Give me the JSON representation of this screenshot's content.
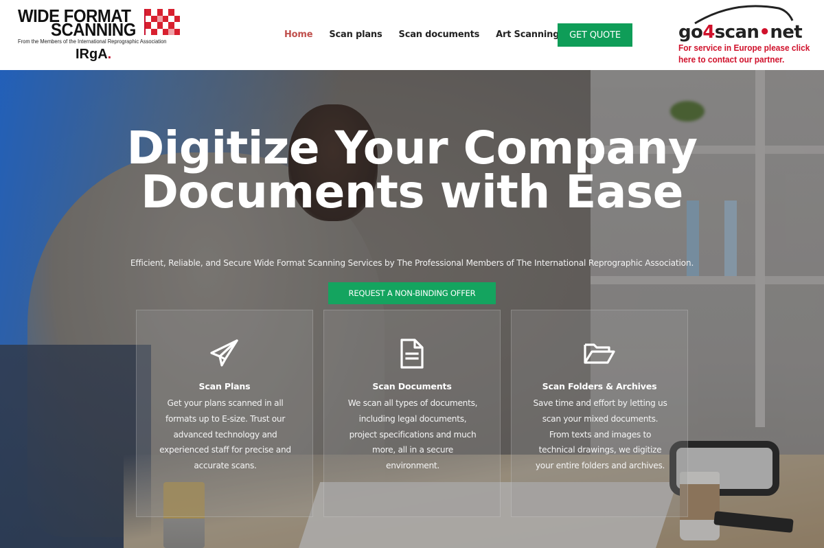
{
  "header": {
    "logo": {
      "line1": "WIDE FORMAT",
      "line2": "SCANNING",
      "tagline": "From the Members of the International Reprographic Association",
      "acronym": "IRgA",
      "acronym_dot": "."
    },
    "nav": [
      {
        "label": "Home",
        "active": true
      },
      {
        "label": "Scan plans",
        "active": false
      },
      {
        "label": "Scan documents",
        "active": false
      },
      {
        "label": "Art Scanning",
        "active": false
      }
    ],
    "quote_button": "GET QUOTE",
    "partner": {
      "brand_part1": "go",
      "brand_part2": "4",
      "brand_part3": "scan",
      "brand_dot": "•",
      "brand_part4": "net",
      "message_line1": "For service in Europe please click",
      "message_line2": "here to contact our partner."
    }
  },
  "hero": {
    "headline_line1": "Digitize Your Company",
    "headline_line2": "Documents with Ease",
    "subheadline": "Efficient, Reliable, and Secure Wide Format Scanning Services by The Professional Members of The International Reprographic Association.",
    "cta_button": "REQUEST A NON-BINDING OFFER"
  },
  "cards": [
    {
      "icon": "paper-plane-icon",
      "title": "Scan Plans",
      "body": "Get your plans scanned in all formats up to E-size. Trust our advanced technology and experienced staff for precise and accurate scans."
    },
    {
      "icon": "document-icon",
      "title": "Scan Documents",
      "body": "We scan all types of documents, including legal documents, project specifications and much more, all in a secure environment."
    },
    {
      "icon": "open-folder-icon",
      "title": "Scan Folders & Archives",
      "body": "Save time and effort by letting us scan your mixed documents. From texts and images to technical drawings, we digitize your entire folders and archives."
    }
  ],
  "colors": {
    "accent_green": "#0f9d58",
    "active_nav": "#c0504d",
    "brand_red": "#d0112b",
    "hero_blue": "#1470f0"
  }
}
